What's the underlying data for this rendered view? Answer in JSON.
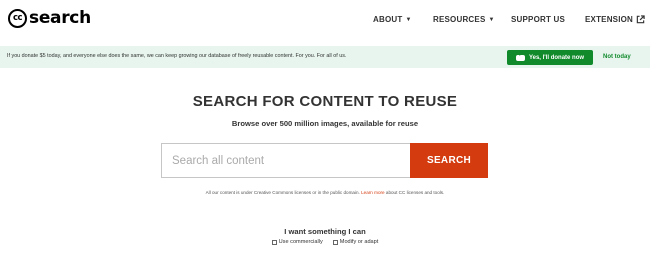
{
  "logo": {
    "cc": "cc",
    "text": "search"
  },
  "nav": {
    "about": "ABOUT",
    "resources": "RESOURCES",
    "support": "SUPPORT US",
    "extension": "EXTENSION",
    "caret": "▼"
  },
  "banner": {
    "message": "If you donate $5 today, and everyone else does the same, we can keep growing our database of freely reusable content. For you. For all of us.",
    "donate_label": "Yes, I'll donate now",
    "dismiss_label": "Not today"
  },
  "main": {
    "title": "SEARCH FOR CONTENT TO REUSE",
    "subtitle": "Browse over 500 million images, available for reuse",
    "search_placeholder": "Search all content",
    "search_button": "SEARCH",
    "license_prefix": "All our content is under Creative Commons licenses or in the public domain. ",
    "license_link": "Learn more",
    "license_suffix": " about CC licenses and tools."
  },
  "filters": {
    "heading": "I want something I can",
    "use_commercially": "Use commercially",
    "modify": "Modify or adapt"
  },
  "colors": {
    "accent": "#d43b0e",
    "donate_green": "#118a2c",
    "banner_bg": "#e7f5ee"
  }
}
